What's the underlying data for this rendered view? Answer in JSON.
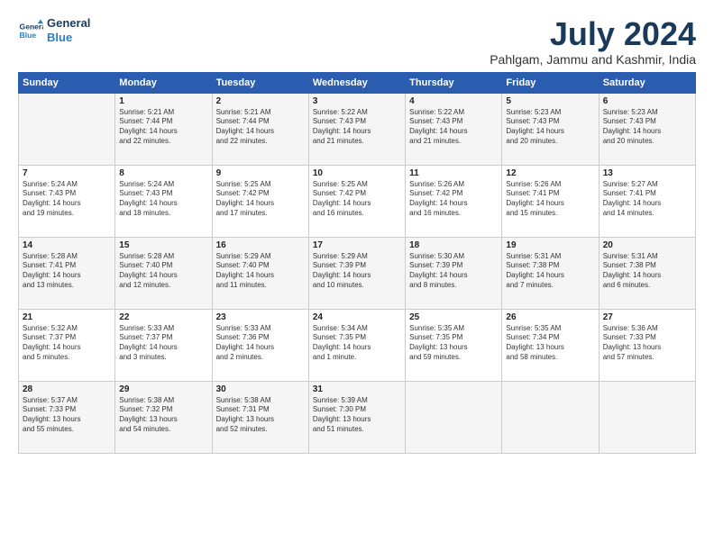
{
  "header": {
    "logo_line1": "General",
    "logo_line2": "Blue",
    "month_title": "July 2024",
    "location": "Pahlgam, Jammu and Kashmir, India"
  },
  "weekdays": [
    "Sunday",
    "Monday",
    "Tuesday",
    "Wednesday",
    "Thursday",
    "Friday",
    "Saturday"
  ],
  "weeks": [
    [
      {
        "day": "",
        "info": ""
      },
      {
        "day": "1",
        "info": "Sunrise: 5:21 AM\nSunset: 7:44 PM\nDaylight: 14 hours\nand 22 minutes."
      },
      {
        "day": "2",
        "info": "Sunrise: 5:21 AM\nSunset: 7:44 PM\nDaylight: 14 hours\nand 22 minutes."
      },
      {
        "day": "3",
        "info": "Sunrise: 5:22 AM\nSunset: 7:43 PM\nDaylight: 14 hours\nand 21 minutes."
      },
      {
        "day": "4",
        "info": "Sunrise: 5:22 AM\nSunset: 7:43 PM\nDaylight: 14 hours\nand 21 minutes."
      },
      {
        "day": "5",
        "info": "Sunrise: 5:23 AM\nSunset: 7:43 PM\nDaylight: 14 hours\nand 20 minutes."
      },
      {
        "day": "6",
        "info": "Sunrise: 5:23 AM\nSunset: 7:43 PM\nDaylight: 14 hours\nand 20 minutes."
      }
    ],
    [
      {
        "day": "7",
        "info": "Sunrise: 5:24 AM\nSunset: 7:43 PM\nDaylight: 14 hours\nand 19 minutes."
      },
      {
        "day": "8",
        "info": "Sunrise: 5:24 AM\nSunset: 7:43 PM\nDaylight: 14 hours\nand 18 minutes."
      },
      {
        "day": "9",
        "info": "Sunrise: 5:25 AM\nSunset: 7:42 PM\nDaylight: 14 hours\nand 17 minutes."
      },
      {
        "day": "10",
        "info": "Sunrise: 5:25 AM\nSunset: 7:42 PM\nDaylight: 14 hours\nand 16 minutes."
      },
      {
        "day": "11",
        "info": "Sunrise: 5:26 AM\nSunset: 7:42 PM\nDaylight: 14 hours\nand 16 minutes."
      },
      {
        "day": "12",
        "info": "Sunrise: 5:26 AM\nSunset: 7:41 PM\nDaylight: 14 hours\nand 15 minutes."
      },
      {
        "day": "13",
        "info": "Sunrise: 5:27 AM\nSunset: 7:41 PM\nDaylight: 14 hours\nand 14 minutes."
      }
    ],
    [
      {
        "day": "14",
        "info": "Sunrise: 5:28 AM\nSunset: 7:41 PM\nDaylight: 14 hours\nand 13 minutes."
      },
      {
        "day": "15",
        "info": "Sunrise: 5:28 AM\nSunset: 7:40 PM\nDaylight: 14 hours\nand 12 minutes."
      },
      {
        "day": "16",
        "info": "Sunrise: 5:29 AM\nSunset: 7:40 PM\nDaylight: 14 hours\nand 11 minutes."
      },
      {
        "day": "17",
        "info": "Sunrise: 5:29 AM\nSunset: 7:39 PM\nDaylight: 14 hours\nand 10 minutes."
      },
      {
        "day": "18",
        "info": "Sunrise: 5:30 AM\nSunset: 7:39 PM\nDaylight: 14 hours\nand 8 minutes."
      },
      {
        "day": "19",
        "info": "Sunrise: 5:31 AM\nSunset: 7:38 PM\nDaylight: 14 hours\nand 7 minutes."
      },
      {
        "day": "20",
        "info": "Sunrise: 5:31 AM\nSunset: 7:38 PM\nDaylight: 14 hours\nand 6 minutes."
      }
    ],
    [
      {
        "day": "21",
        "info": "Sunrise: 5:32 AM\nSunset: 7:37 PM\nDaylight: 14 hours\nand 5 minutes."
      },
      {
        "day": "22",
        "info": "Sunrise: 5:33 AM\nSunset: 7:37 PM\nDaylight: 14 hours\nand 3 minutes."
      },
      {
        "day": "23",
        "info": "Sunrise: 5:33 AM\nSunset: 7:36 PM\nDaylight: 14 hours\nand 2 minutes."
      },
      {
        "day": "24",
        "info": "Sunrise: 5:34 AM\nSunset: 7:35 PM\nDaylight: 14 hours\nand 1 minute."
      },
      {
        "day": "25",
        "info": "Sunrise: 5:35 AM\nSunset: 7:35 PM\nDaylight: 13 hours\nand 59 minutes."
      },
      {
        "day": "26",
        "info": "Sunrise: 5:35 AM\nSunset: 7:34 PM\nDaylight: 13 hours\nand 58 minutes."
      },
      {
        "day": "27",
        "info": "Sunrise: 5:36 AM\nSunset: 7:33 PM\nDaylight: 13 hours\nand 57 minutes."
      }
    ],
    [
      {
        "day": "28",
        "info": "Sunrise: 5:37 AM\nSunset: 7:33 PM\nDaylight: 13 hours\nand 55 minutes."
      },
      {
        "day": "29",
        "info": "Sunrise: 5:38 AM\nSunset: 7:32 PM\nDaylight: 13 hours\nand 54 minutes."
      },
      {
        "day": "30",
        "info": "Sunrise: 5:38 AM\nSunset: 7:31 PM\nDaylight: 13 hours\nand 52 minutes."
      },
      {
        "day": "31",
        "info": "Sunrise: 5:39 AM\nSunset: 7:30 PM\nDaylight: 13 hours\nand 51 minutes."
      },
      {
        "day": "",
        "info": ""
      },
      {
        "day": "",
        "info": ""
      },
      {
        "day": "",
        "info": ""
      }
    ]
  ]
}
